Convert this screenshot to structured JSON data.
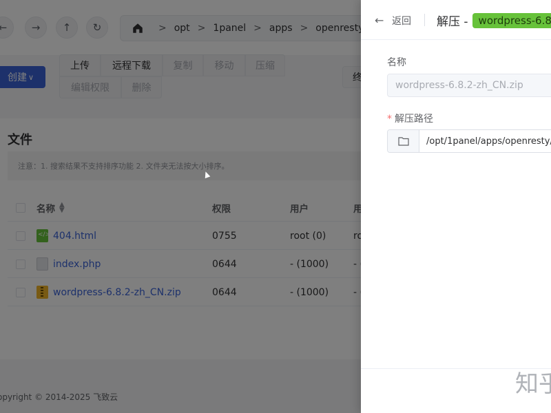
{
  "breadcrumb": {
    "items": [
      "opt",
      "1panel",
      "apps",
      "openresty",
      "ope"
    ],
    "separator": ">"
  },
  "toolbar": {
    "create_label": "创建",
    "buttons": [
      "上传",
      "远程下载",
      "复制",
      "移动",
      "压缩",
      "编辑权限",
      "删除"
    ],
    "right_partial": "终"
  },
  "files": {
    "title": "文件",
    "notice": "注意：1. 搜索结果不支持排序功能 2. 文件夹无法按大小排序。",
    "columns": [
      "名称",
      "权限",
      "用户",
      "用"
    ],
    "rows": [
      {
        "name": "404.html",
        "perm": "0755",
        "user": "root (0)",
        "extra": "ro",
        "icon": "html-file-icon"
      },
      {
        "name": "index.php",
        "perm": "0644",
        "user": "- (1000)",
        "extra": "- (",
        "icon": "php-file-icon"
      },
      {
        "name": "wordpress-6.8.2-zh_CN.zip",
        "perm": "0644",
        "user": "- (1000)",
        "extra": "- (",
        "icon": "zip-file-icon"
      }
    ]
  },
  "footer": {
    "copyright": "opyright © 2014-2025 飞致云"
  },
  "drawer": {
    "back_label": "返回",
    "title": "解压 -",
    "tag": "wordpress-6.8",
    "name_label": "名称",
    "name_value": "wordpress-6.8.2-zh_CN.zip",
    "path_label": "解压路径",
    "path_value": "/opt/1panel/apps/openresty/c"
  },
  "watermark": "知乎",
  "colors": {
    "primary": "#3a62d7",
    "tag_green": "#67c23a",
    "required": "#f56c6c"
  }
}
